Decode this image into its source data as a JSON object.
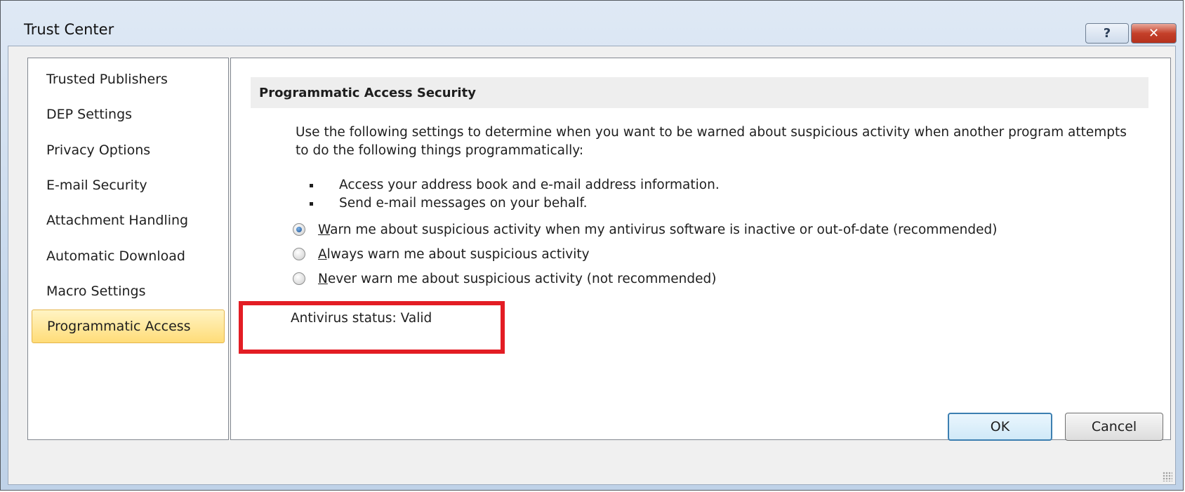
{
  "window": {
    "title": "Trust Center",
    "help_label": "?",
    "close_label": "✕"
  },
  "sidebar": {
    "items": [
      {
        "label": "Trusted Publishers",
        "selected": false
      },
      {
        "label": "DEP Settings",
        "selected": false
      },
      {
        "label": "Privacy Options",
        "selected": false
      },
      {
        "label": "E-mail Security",
        "selected": false
      },
      {
        "label": "Attachment Handling",
        "selected": false
      },
      {
        "label": "Automatic Download",
        "selected": false
      },
      {
        "label": "Macro Settings",
        "selected": false
      },
      {
        "label": "Programmatic Access",
        "selected": true
      }
    ]
  },
  "content": {
    "section_title": "Programmatic Access Security",
    "description": "Use the following settings to determine when you want to be warned about suspicious activity when another program attempts to do the following things programmatically:",
    "bullets": [
      "Access your address book and e-mail address information.",
      "Send e-mail messages on your behalf."
    ],
    "options": [
      {
        "accel": "W",
        "rest": "arn me about suspicious activity when my antivirus software is inactive or out-of-date (recommended)",
        "checked": true
      },
      {
        "accel": "A",
        "rest": "lways warn me about suspicious activity",
        "checked": false
      },
      {
        "accel": "N",
        "rest": "ever warn me about suspicious activity (not recommended)",
        "checked": false
      }
    ],
    "antivirus_status": "Antivirus status: Valid"
  },
  "footer": {
    "ok_label": "OK",
    "cancel_label": "Cancel"
  },
  "colors": {
    "highlight_box": "#e31d24",
    "selected_item": "#ffdc78"
  }
}
